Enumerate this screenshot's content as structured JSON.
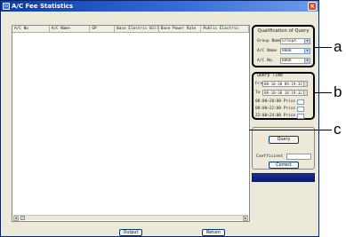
{
  "window": {
    "title": "A/C Fee Statistics",
    "icon": "app-icon",
    "close_icon": "close-icon"
  },
  "grid": {
    "columns": [
      "A/C No",
      "A/C Name",
      "GP",
      "Base Electric Bill",
      "Base Power Rate",
      "Public Electric"
    ],
    "scroll_left_icon": "arrow-left-icon",
    "scroll_right_icon": "arrow-right-icon"
  },
  "qualification": {
    "title": "Qualification of Query",
    "group_name_label": "Group Name",
    "group_name_value": "GroupA",
    "ac_name_label": "A/C Name",
    "ac_name_value": "0000",
    "ac_no_label": "A/C No.",
    "ac_no_value": "0000"
  },
  "query_time": {
    "title": "Query Time",
    "from_label": "From",
    "from_value": "08-10-30 09:19:32",
    "to_label": "To",
    "to_value": "08-10-30 18:19:32",
    "price_rows": [
      "08:00~20:00 Price",
      "08:00~22:00 Price",
      "22:00~24:00 Price"
    ]
  },
  "controls": {
    "query_label": "Query",
    "coefficient_label": "Coefficient",
    "correct_label": "Correct"
  },
  "footer": {
    "output_label": "Output",
    "return_label": "Return"
  },
  "callouts": [
    "a",
    "b",
    "c"
  ],
  "colors": {
    "title_bar": "#0a3cae",
    "progress_bar": "#1b2f96",
    "window_bg": "#ece9d8"
  }
}
